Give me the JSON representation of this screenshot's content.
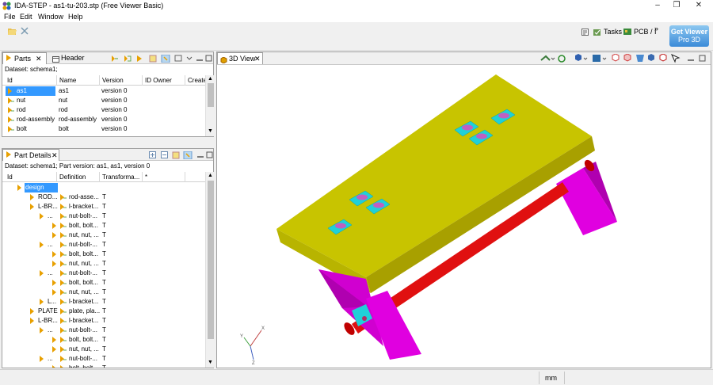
{
  "window": {
    "title": "IDA-STEP - as1-tu-203.stp (Free Viewer Basic)",
    "minimize": "–",
    "restore": "❐",
    "close": "✕"
  },
  "menu": [
    "File",
    "Edit",
    "Window",
    "Help"
  ],
  "toolbar": {
    "tasks_label": "Tasks",
    "pcb_label": "PCB / I",
    "more": "»",
    "promo_line1": "Get Viewer",
    "promo_line2": "Pro 3D"
  },
  "parts": {
    "tab_label": "Parts",
    "header_tab_label": "Header",
    "dataset": "Dataset: schema1;",
    "columns": [
      "Id",
      "Name",
      "Version",
      "ID Owner",
      "Create"
    ],
    "rows": [
      {
        "id": "as1",
        "name": "as1",
        "version": "version 0"
      },
      {
        "id": "nut",
        "name": "nut",
        "version": "version 0"
      },
      {
        "id": "rod",
        "name": "rod",
        "version": "version 0"
      },
      {
        "id": "rod-assembly",
        "name": "rod-assembly",
        "version": "version 0"
      },
      {
        "id": "bolt",
        "name": "bolt",
        "version": "version 0"
      }
    ]
  },
  "details": {
    "tab_label": "Part Details",
    "dataset": "Dataset: schema1; Part version: as1, as1, version 0",
    "columns": [
      "Id",
      "Definition",
      "Transforma...",
      "*"
    ],
    "rows": [
      {
        "id": "design",
        "def": "",
        "t": ""
      },
      {
        "id": "ROD...",
        "def": "rod-asse...",
        "t": "T"
      },
      {
        "id": "L-BR...",
        "def": "l-bracket...",
        "t": "T"
      },
      {
        "id": "...",
        "def": "nut-bolt-...",
        "t": "T"
      },
      {
        "id": "",
        "def": "bolt, bolt...",
        "t": "T"
      },
      {
        "id": "",
        "def": "nut, nut, ...",
        "t": "T"
      },
      {
        "id": "...",
        "def": "nut-bolt-...",
        "t": "T"
      },
      {
        "id": "",
        "def": "bolt, bolt...",
        "t": "T"
      },
      {
        "id": "",
        "def": "nut, nut, ...",
        "t": "T"
      },
      {
        "id": "...",
        "def": "nut-bolt-...",
        "t": "T"
      },
      {
        "id": "",
        "def": "bolt, bolt...",
        "t": "T"
      },
      {
        "id": "",
        "def": "nut, nut, ...",
        "t": "T"
      },
      {
        "id": "L...",
        "def": "l-bracket...",
        "t": "T"
      },
      {
        "id": "PLATE",
        "def": "plate, pla...",
        "t": "T"
      },
      {
        "id": "L-BR...",
        "def": "l-bracket...",
        "t": "T"
      },
      {
        "id": "...",
        "def": "nut-bolt-...",
        "t": "T"
      },
      {
        "id": "",
        "def": "bolt, bolt...",
        "t": "T"
      },
      {
        "id": "",
        "def": "nut, nut, ...",
        "t": "T"
      },
      {
        "id": "...",
        "def": "nut-bolt-...",
        "t": "T"
      },
      {
        "id": "",
        "def": "bolt, bolt...",
        "t": "T"
      }
    ]
  },
  "view3d": {
    "tab_label": "3D View",
    "axis_x": "X",
    "axis_y": "Y",
    "axis_z": "Z"
  },
  "status": {
    "units": "mm"
  },
  "colors": {
    "plate": "#c8c400",
    "bracket": "#e000e0",
    "rod": "#e01010",
    "nut": "#20d0d8",
    "bolt": "#c060c0"
  }
}
